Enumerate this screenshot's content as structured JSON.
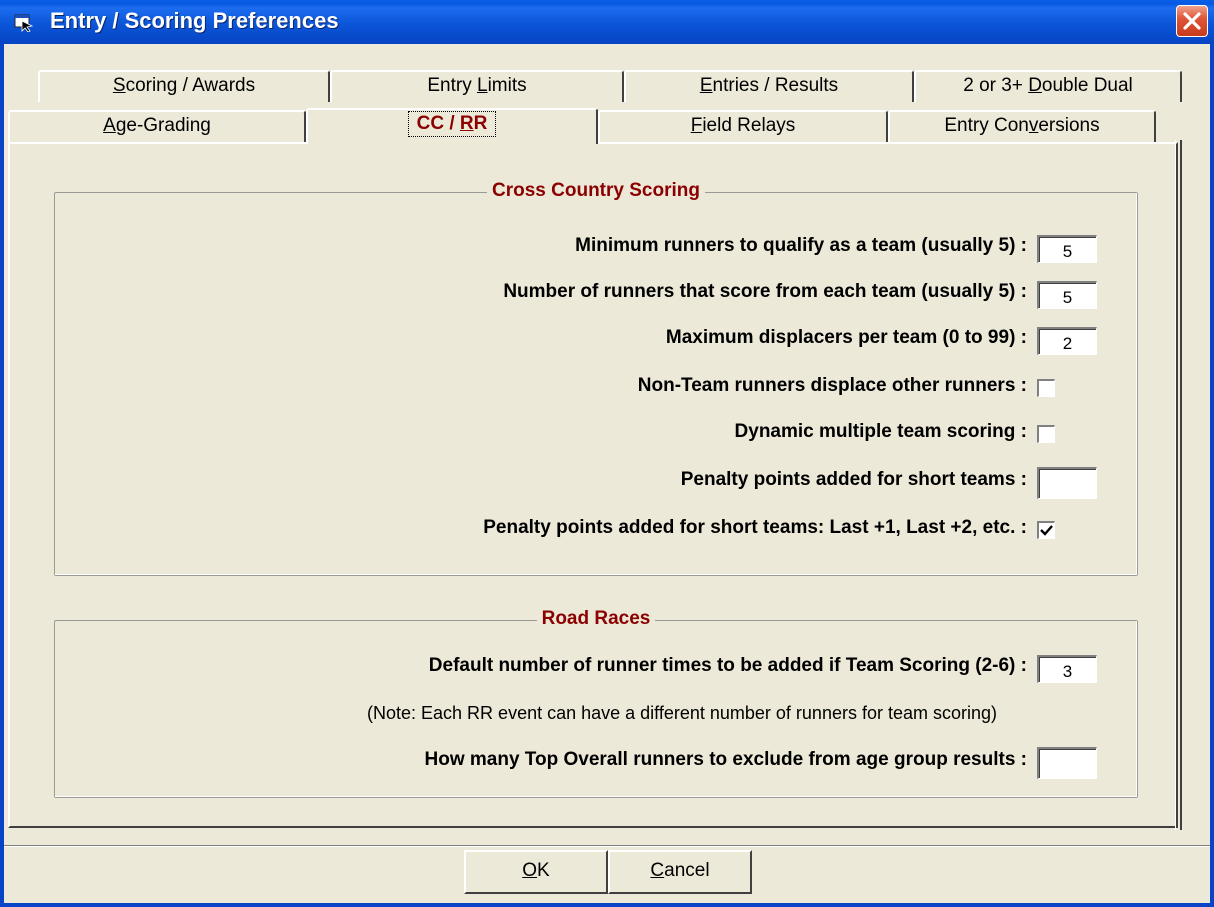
{
  "window": {
    "title": "Entry / Scoring Preferences"
  },
  "tabs_row1": [
    {
      "pre": "",
      "key": "S",
      "post": "coring / Awards"
    },
    {
      "pre": "Entry ",
      "key": "L",
      "post": "imits"
    },
    {
      "pre": "",
      "key": "E",
      "post": "ntries / Results"
    },
    {
      "pre": "2 or 3+ ",
      "key": "D",
      "post": "ouble Dual"
    }
  ],
  "tabs_row2": [
    {
      "pre": "",
      "key": "A",
      "post": "ge-Grading"
    },
    {
      "pre": "CC / ",
      "key": "R",
      "post": "R"
    },
    {
      "pre": "",
      "key": "F",
      "post": "ield Relays"
    },
    {
      "pre": "Entry Con",
      "key": "v",
      "post": "ersions"
    }
  ],
  "cross_country": {
    "title": "Cross Country Scoring",
    "min_runners_label": "Minimum runners to qualify as a team (usually 5) :",
    "min_runners_value": "5",
    "scoring_runners_label": "Number of runners that score from each team (usually 5) :",
    "scoring_runners_value": "5",
    "max_displacers_label": "Maximum displacers per team (0 to 99) :",
    "max_displacers_value": "2",
    "non_team_label": "Non-Team runners displace other runners :",
    "non_team_checked": false,
    "dynamic_label": "Dynamic multiple team scoring :",
    "dynamic_checked": false,
    "penalty_label": "Penalty points added for short teams :",
    "penalty_value": "",
    "penalty_last_label": "Penalty points added for short teams: Last +1, Last +2, etc. :",
    "penalty_last_checked": true
  },
  "road_races": {
    "title": "Road Races",
    "default_times_label": "Default number of runner times to be added if Team Scoring (2-6) :",
    "default_times_value": "3",
    "note": "(Note: Each RR event can have a different number of runners for team scoring)",
    "exclude_label": "How many Top Overall runners to exclude from age group results :",
    "exclude_value": ""
  },
  "buttons": {
    "ok_key": "O",
    "ok_rest": "K",
    "cancel_key": "C",
    "cancel_rest": "ancel"
  },
  "colors": {
    "title_bar": "#0a5fe6",
    "accent_red": "#8b0000",
    "face": "#ece9d8"
  }
}
